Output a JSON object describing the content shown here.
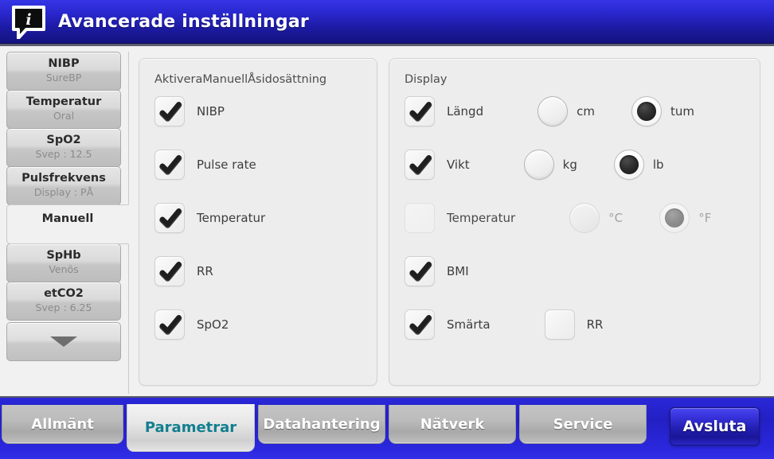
{
  "window": {
    "title": "Avancerade inställningar",
    "icon": "info-speech-bubble-icon",
    "title_bar_color": "#2a27cf",
    "accent_color": "#127f8f"
  },
  "sidebar": {
    "items": [
      {
        "title": "NIBP",
        "subtitle": "SureBP",
        "selected": false
      },
      {
        "title": "Temperatur",
        "subtitle": "Oral",
        "selected": false
      },
      {
        "title": "SpO2",
        "subtitle": "Svep : 12.5",
        "selected": false
      },
      {
        "title": "Pulsfrekvens",
        "subtitle": "Display : PÅ",
        "selected": false
      },
      {
        "title": "Manuell",
        "subtitle": "",
        "selected": true
      },
      {
        "title": "SpHb",
        "subtitle": "Venös",
        "selected": false
      },
      {
        "title": "etCO2",
        "subtitle": "Svep : 6.25",
        "selected": false
      }
    ],
    "scroll_down": {
      "icon": "chevron-down-icon",
      "label": ""
    }
  },
  "panels": {
    "manual_override": {
      "title": "AktiveraManuellÅsidosättning",
      "checkboxes": [
        {
          "label": "NIBP",
          "checked": true,
          "enabled": true
        },
        {
          "label": "Pulse rate",
          "checked": true,
          "enabled": true
        },
        {
          "label": "Temperatur",
          "checked": true,
          "enabled": true
        },
        {
          "label": "RR",
          "checked": true,
          "enabled": true
        },
        {
          "label": "SpO2",
          "checked": true,
          "enabled": true
        }
      ]
    },
    "display": {
      "title": "Display",
      "rows": [
        {
          "label": "Längd",
          "checked": true,
          "enabled": true,
          "units": [
            {
              "label": "cm",
              "selected": false,
              "enabled": true
            },
            {
              "label": "tum",
              "selected": true,
              "enabled": true
            }
          ]
        },
        {
          "label": "Vikt",
          "checked": true,
          "enabled": true,
          "units": [
            {
              "label": "kg",
              "selected": false,
              "enabled": true
            },
            {
              "label": "lb",
              "selected": true,
              "enabled": true
            }
          ]
        },
        {
          "label": "Temperatur",
          "checked": false,
          "enabled": false,
          "units": [
            {
              "label": "°C",
              "selected": false,
              "enabled": false
            },
            {
              "label": "°F",
              "selected": true,
              "enabled": false
            }
          ]
        },
        {
          "label": "BMI",
          "checked": true,
          "enabled": true,
          "units": []
        },
        {
          "label": "Smärta",
          "checked": true,
          "enabled": true,
          "extra_checkbox": {
            "label": "RR",
            "checked": false,
            "enabled": true
          },
          "units": []
        }
      ]
    }
  },
  "tabbar": {
    "tabs": [
      {
        "label": "Allmänt",
        "active": false
      },
      {
        "label": "Parametrar",
        "active": true
      },
      {
        "label": "Datahantering",
        "active": false
      },
      {
        "label": "Nätverk",
        "active": false
      },
      {
        "label": "Service",
        "active": false
      }
    ],
    "exit_button": "Avsluta"
  }
}
